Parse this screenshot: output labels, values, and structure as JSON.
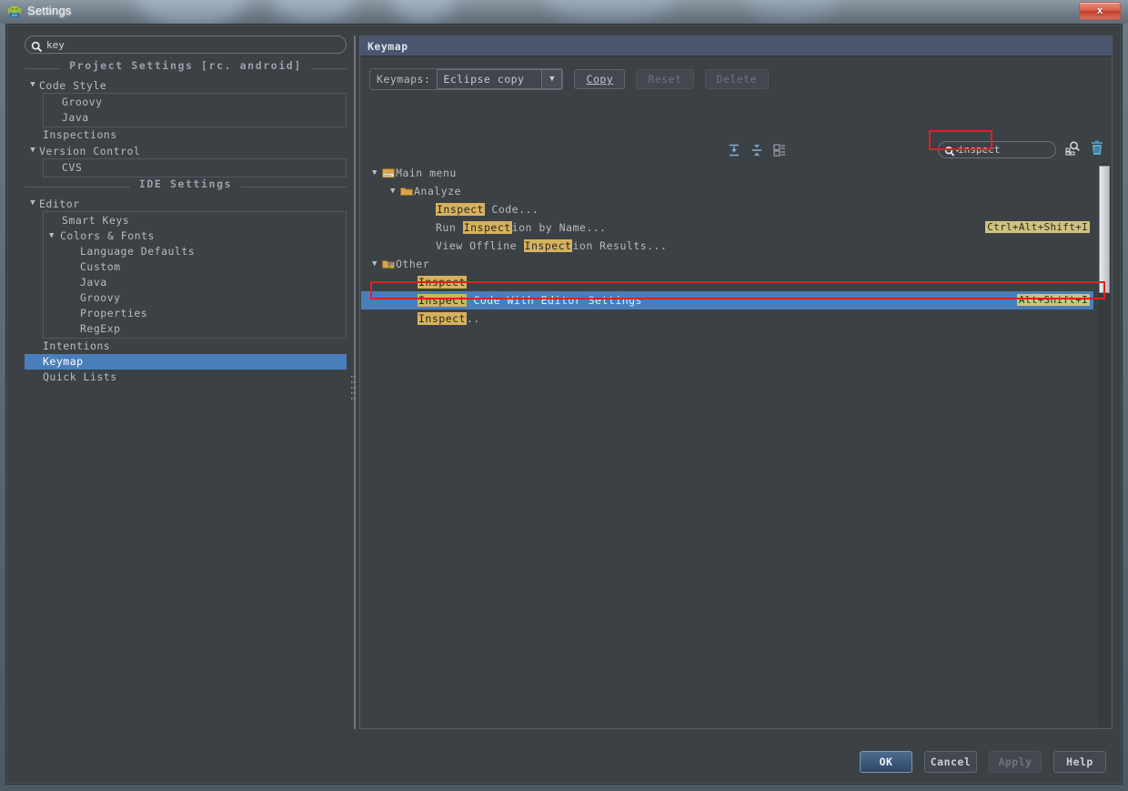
{
  "window": {
    "title": "Settings",
    "app_icon": "android-robot-icon",
    "close_label": "x"
  },
  "left": {
    "search": {
      "value": "key",
      "placeholder": "",
      "icon": "search-icon"
    },
    "sections": [
      {
        "type": "separator",
        "label": "Project Settings [rc. android]"
      },
      {
        "type": "group",
        "label": "Code Style",
        "expanded": true,
        "children": [
          "Groovy",
          "Java"
        ]
      },
      {
        "type": "item",
        "label": "Inspections"
      },
      {
        "type": "group",
        "label": "Version Control",
        "expanded": true,
        "children": [
          "CVS"
        ]
      },
      {
        "type": "separator",
        "label": "IDE Settings"
      },
      {
        "type": "group",
        "label": "Editor",
        "expanded": true,
        "children": [
          "Smart Keys",
          "Colors & Fonts"
        ],
        "grandchildren": [
          "Language Defaults",
          "Custom",
          "Java",
          "Groovy",
          "Properties",
          "RegExp"
        ]
      },
      {
        "type": "item",
        "label": "Intentions"
      },
      {
        "type": "item",
        "label": "Keymap",
        "selected": true
      },
      {
        "type": "item",
        "label": "Quick Lists"
      }
    ]
  },
  "right": {
    "header": "Keymap",
    "keymaps_label": "Keymaps:",
    "keymap_value": "Eclipse copy",
    "dropdown_icon": "chevron-down-icon",
    "buttons": [
      {
        "label": "Copy",
        "enabled": true,
        "mnemonic": "C"
      },
      {
        "label": "Reset",
        "enabled": false
      },
      {
        "label": "Delete",
        "enabled": false
      }
    ],
    "tool_icons": [
      "expand-all-icon",
      "collapse-all-icon",
      "edit-shortcut-icon"
    ],
    "filter": {
      "value": "inspect",
      "icon": "search-dropdown-icon",
      "find_shortcut_icon": "find-by-shortcut-icon",
      "clear_icon": "trash-icon"
    },
    "tree": [
      {
        "indent": 0,
        "twisty": "expanded",
        "icon": "main-menu-icon",
        "label": "Main menu",
        "shortcut": ""
      },
      {
        "indent": 1,
        "twisty": "expanded",
        "icon": "folder-icon",
        "label": "Analyze",
        "shortcut": ""
      },
      {
        "indent": 2,
        "twisty": "none",
        "icon": "none",
        "pre": "",
        "match": "Inspect",
        "post": " Code...",
        "shortcut": ""
      },
      {
        "indent": 2,
        "twisty": "none",
        "icon": "none",
        "pre": "Run ",
        "match": "Inspect",
        "post": "ion by Name...",
        "shortcut": "Ctrl+Alt+Shift+I"
      },
      {
        "indent": 2,
        "twisty": "none",
        "icon": "none",
        "pre": "View Offline ",
        "match": "Inspect",
        "post": "ion Results...",
        "shortcut": ""
      },
      {
        "indent": 0,
        "twisty": "expanded",
        "icon": "other-icon",
        "label": "Other",
        "shortcut": ""
      },
      {
        "indent": 2,
        "twisty": "none",
        "icon": "none",
        "pre": "",
        "match": "Inspect",
        "post": "",
        "shortcut": ""
      },
      {
        "indent": 2,
        "twisty": "none",
        "icon": "none",
        "pre": "",
        "match": "Inspect",
        "post": " Code With Editor Settings",
        "shortcut": "Alt+Shift+I",
        "selected": true
      },
      {
        "indent": 2,
        "twisty": "none",
        "icon": "none",
        "pre": "",
        "match": "Inspect",
        "post": "..",
        "shortcut": ""
      }
    ]
  },
  "footer": {
    "ok": "OK",
    "cancel": "Cancel",
    "apply": "Apply",
    "help": "Help"
  },
  "colors": {
    "selection": "#4a7ebb",
    "match_highlight": "#d6b25e",
    "shortcut_highlight": "#cfc37e",
    "annotation": "#e02020",
    "panel_header": "#4a5570"
  }
}
